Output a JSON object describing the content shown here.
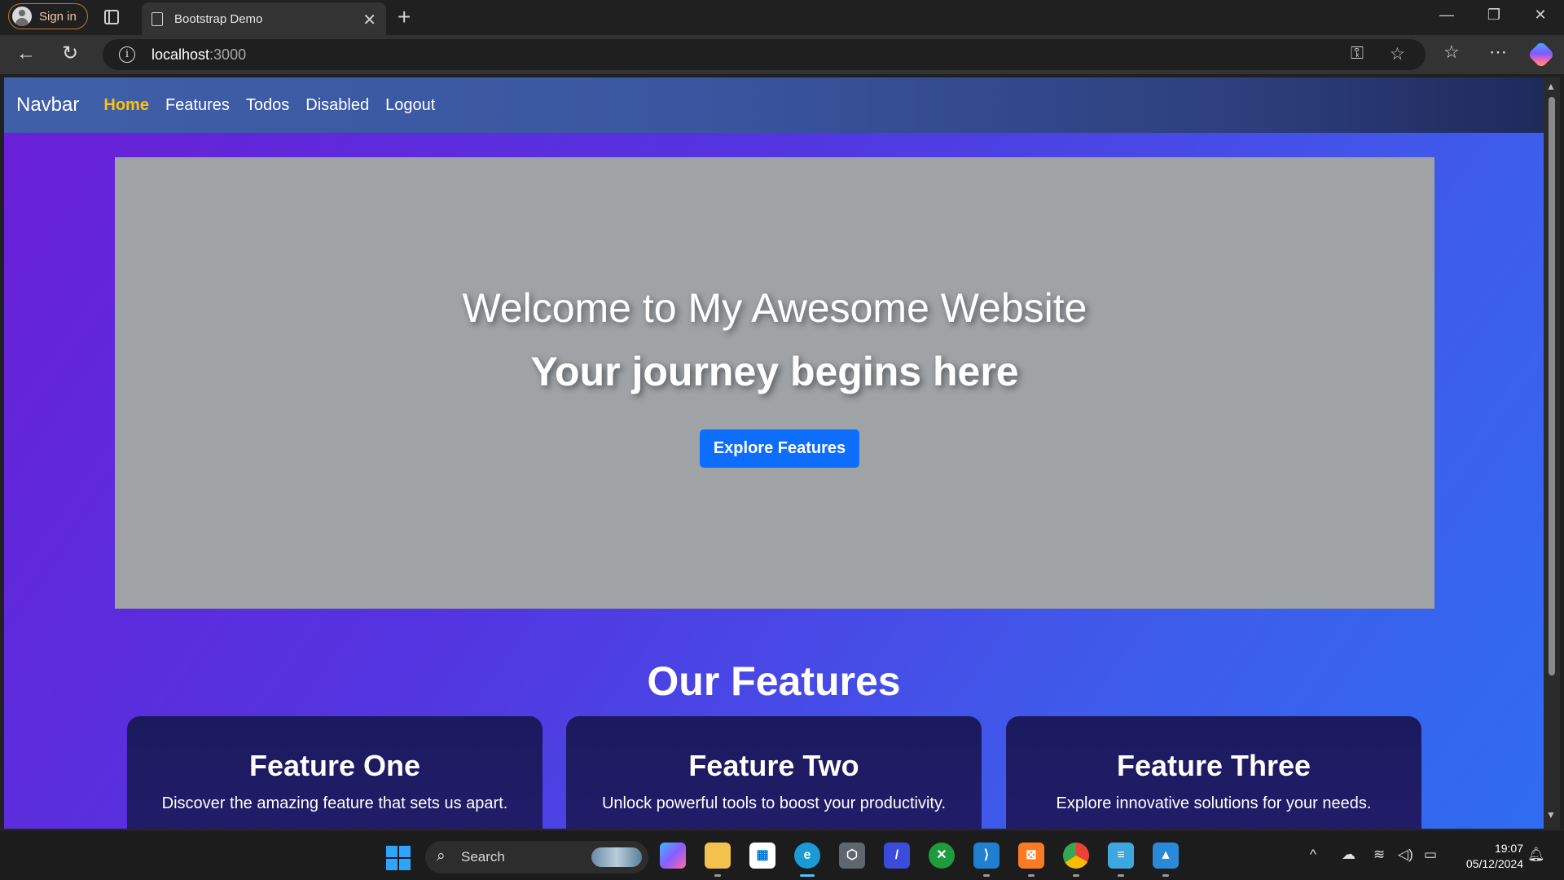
{
  "browser": {
    "signin_label": "Sign in",
    "tab_title": "Bootstrap Demo",
    "url_host": "localhost",
    "url_port": ":3000"
  },
  "page": {
    "navbar": {
      "brand": "Navbar",
      "links": [
        "Home",
        "Features",
        "Todos",
        "Disabled",
        "Logout"
      ],
      "active_link": "Home"
    },
    "hero": {
      "title": "Welcome to My Awesome Website",
      "subtitle": "Your journey begins here",
      "cta_label": "Explore Features"
    },
    "features": {
      "heading": "Our Features",
      "cards": [
        {
          "title": "Feature One",
          "text": "Discover the amazing feature that sets us apart."
        },
        {
          "title": "Feature Two",
          "text": "Unlock powerful tools to boost your productivity."
        },
        {
          "title": "Feature Three",
          "text": "Explore innovative solutions for your needs."
        }
      ]
    }
  },
  "taskbar": {
    "search_label": "Search",
    "time": "19:07",
    "date": "05/12/2024"
  },
  "colors": {
    "active_nav": "#ffc107",
    "cta": "#0d6efd",
    "hero_bg": "#9fa3a6"
  }
}
